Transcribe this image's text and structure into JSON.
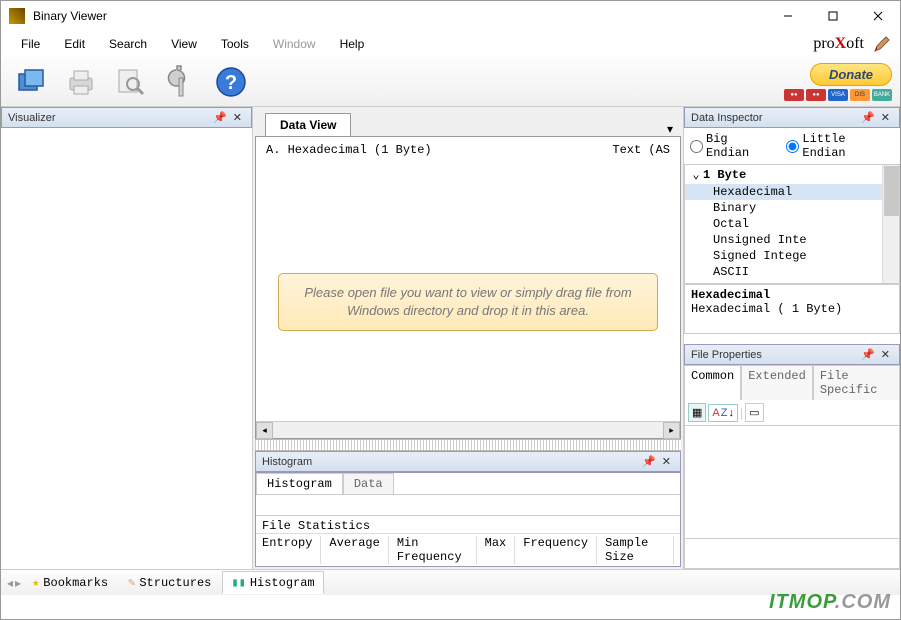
{
  "window": {
    "title": "Binary Viewer"
  },
  "menu": {
    "items": [
      "File",
      "Edit",
      "Search",
      "View",
      "Tools",
      "Window",
      "Help"
    ],
    "disabled_index": 5
  },
  "logo": {
    "pre": "pro",
    "x": "X",
    "post": "oft"
  },
  "donate": {
    "label": "Donate"
  },
  "visualizer": {
    "title": "Visualizer"
  },
  "dataview": {
    "tab": "Data View",
    "col_left": "A.  Hexadecimal (1 Byte)",
    "col_right": "Text (AS",
    "placeholder": "Please open file you want to view or simply drag file from Windows directory and drop it in this area."
  },
  "histogram": {
    "title": "Histogram",
    "tabs": [
      "Histogram",
      "Data"
    ],
    "stats_title": "File Statistics",
    "cols": [
      "Entropy",
      "Average",
      "Min Frequency",
      "Max",
      "Frequency",
      "Sample Size"
    ]
  },
  "inspector": {
    "title": "Data Inspector",
    "endian_big": "Big Endian",
    "endian_little": "Little Endian",
    "group": "1 Byte",
    "items": [
      "Hexadecimal",
      "Binary",
      "Octal",
      "Unsigned Inte",
      "Signed Intege",
      "ASCII"
    ],
    "detail_title": "Hexadecimal",
    "detail_sub": "Hexadecimal ( 1 Byte)"
  },
  "fileprops": {
    "title": "File Properties",
    "tabs": [
      "Common",
      "Extended",
      "File Specific"
    ]
  },
  "statusbar": {
    "tabs": [
      {
        "icon": "star",
        "label": "Bookmarks"
      },
      {
        "icon": "pencil",
        "label": "Structures"
      },
      {
        "icon": "chart",
        "label": "Histogram"
      }
    ],
    "active": 2
  },
  "watermark": {
    "a": "ITMOP",
    "b": ".COM"
  }
}
